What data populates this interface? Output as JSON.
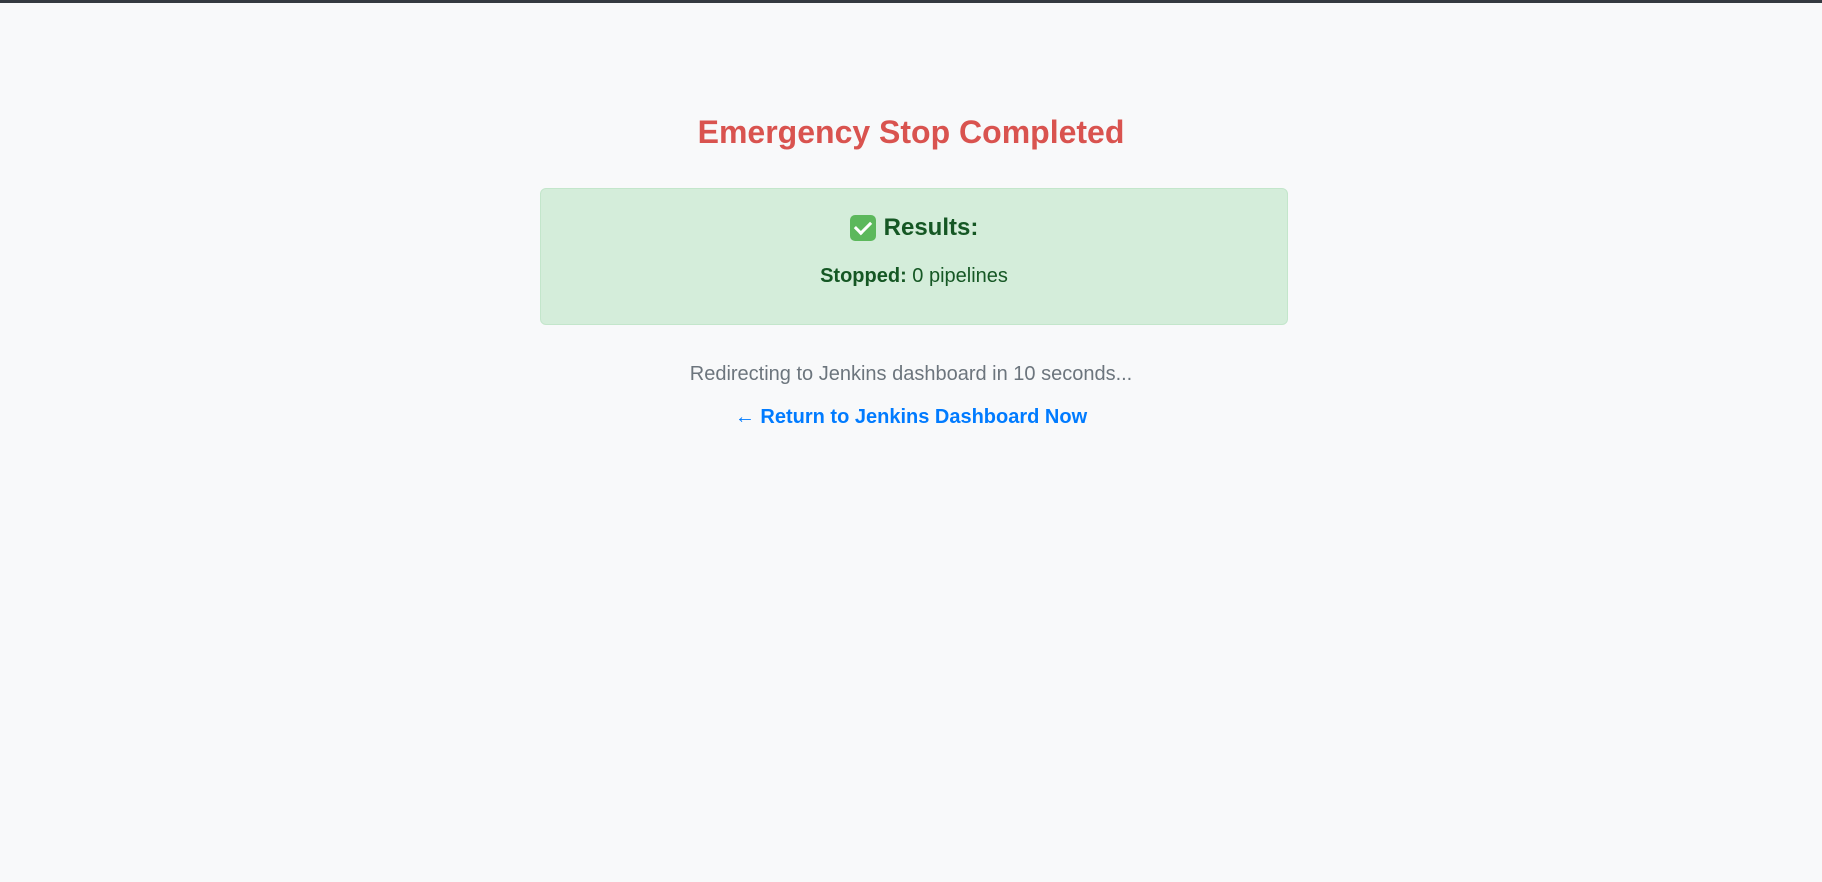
{
  "page": {
    "title": "Emergency Stop Completed"
  },
  "results": {
    "heading": "Results:",
    "icon": "check-mark-icon",
    "stopped_label": "Stopped:",
    "stopped_value": "0 pipelines"
  },
  "redirect": {
    "message": "Redirecting to Jenkins dashboard in 10 seconds...",
    "link_arrow": "←",
    "link_label": "Return to Jenkins Dashboard Now"
  },
  "colors": {
    "title": "#d9534f",
    "results_bg": "#d4edda",
    "results_text": "#155724",
    "link": "#007bff",
    "muted": "#6c757d",
    "page_bg": "#f8f9fa"
  }
}
